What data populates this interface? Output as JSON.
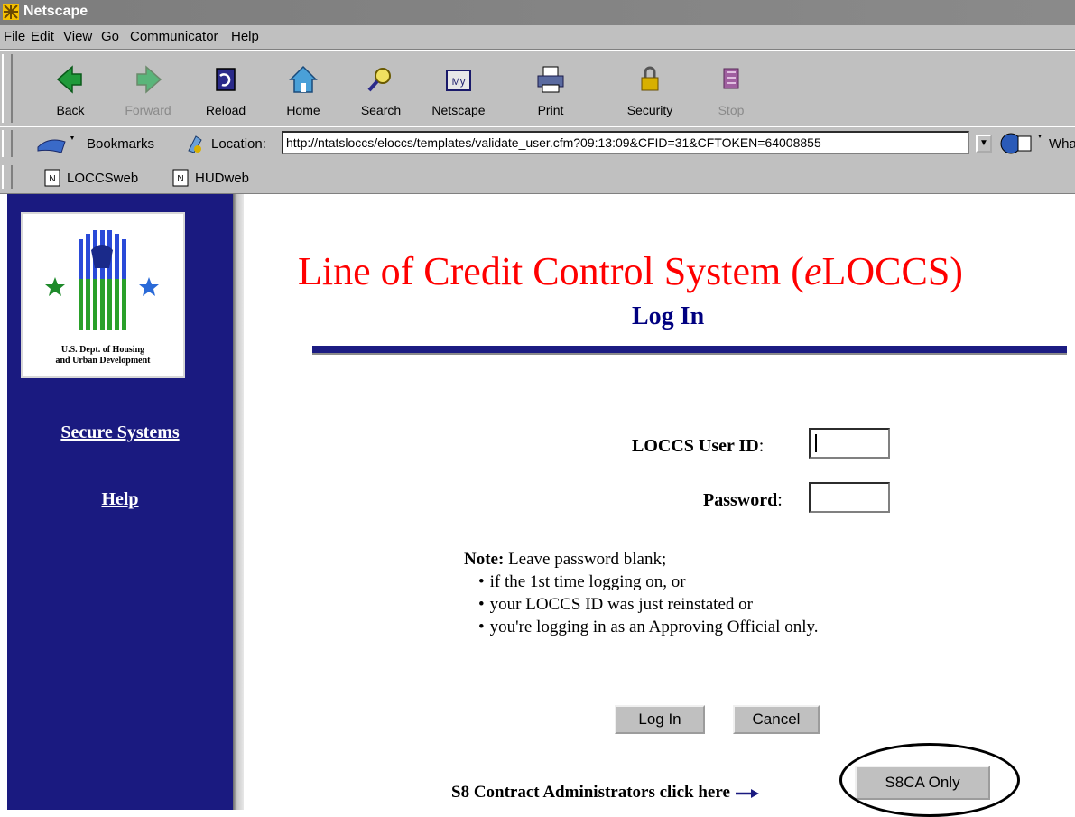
{
  "window": {
    "title": "Netscape"
  },
  "menu": [
    "File",
    "Edit",
    "View",
    "Go",
    "Communicator",
    "Help"
  ],
  "nav_buttons": [
    {
      "label": "Back",
      "icon": "back-arrow-icon",
      "enabled": true
    },
    {
      "label": "Forward",
      "icon": "forward-arrow-icon",
      "enabled": false
    },
    {
      "label": "Reload",
      "icon": "reload-icon",
      "enabled": true
    },
    {
      "label": "Home",
      "icon": "home-icon",
      "enabled": true
    },
    {
      "label": "Search",
      "icon": "search-icon",
      "enabled": true
    },
    {
      "label": "Netscape",
      "icon": "my-netscape-icon",
      "enabled": true
    },
    {
      "label": "Print",
      "icon": "printer-icon",
      "enabled": true
    },
    {
      "label": "Security",
      "icon": "lock-icon",
      "enabled": true
    },
    {
      "label": "Stop",
      "icon": "stop-icon",
      "enabled": false
    }
  ],
  "location_bar": {
    "bookmarks_label": "Bookmarks",
    "location_label": "Location:",
    "url": "http://ntatsloccs/eloccs/templates/validate_user.cfm?09:13:09&CFID=31&CFTOKEN=64008855",
    "whats_related_label": "Wha"
  },
  "personal_toolbar": [
    "LOCCSweb",
    "HUDweb"
  ],
  "sidebar": {
    "logo_caption_line1": "U.S. Dept. of Housing",
    "logo_caption_line2": "and Urban Development",
    "links": [
      "Secure Systems",
      "Help"
    ]
  },
  "page": {
    "title_pre": "Line of Credit Control System (",
    "title_em": "e",
    "title_post": "LOCCS)",
    "subtitle": "Log In",
    "user_id_label": "LOCCS User ID",
    "password_label": "Password",
    "label_colon": ":",
    "note_label": "Note:",
    "note_text": " Leave password blank;",
    "note_items": [
      "if the 1st time logging on, or",
      "your LOCCS ID was just reinstated or",
      "you're logging in as an Approving Official only."
    ],
    "login_button": "Log In",
    "cancel_button": "Cancel",
    "s8_text": "S8 Contract Administrators click here",
    "s8_button": "S8CA Only"
  },
  "colors": {
    "title": "#ff0000",
    "subtitle": "#000080",
    "sidebar": "#1a1a80",
    "chrome": "#c0c0c0"
  }
}
